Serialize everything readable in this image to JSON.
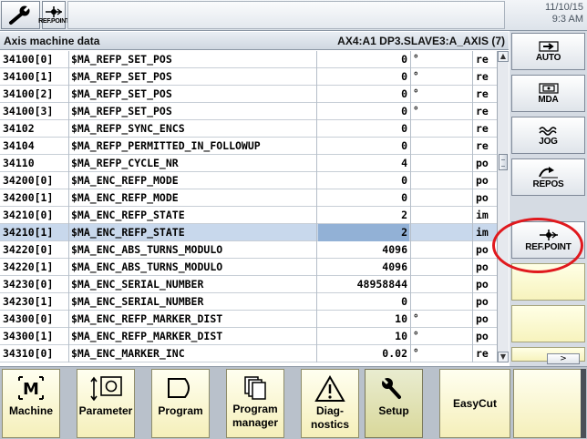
{
  "topbar": {
    "refpoint_label": "REF.POINT",
    "date": "11/10/15",
    "time": "9:3 AM"
  },
  "header": {
    "title": "Axis machine data",
    "axis_info": "AX4:A1 DP3.SLAVE3:A_AXIS (7)"
  },
  "table": {
    "rows": [
      {
        "num": "34100[0]",
        "name": "$MA_REFP_SET_POS",
        "value": "0",
        "unit": "°",
        "act": "re",
        "selected": false
      },
      {
        "num": "34100[1]",
        "name": "$MA_REFP_SET_POS",
        "value": "0",
        "unit": "°",
        "act": "re",
        "selected": false
      },
      {
        "num": "34100[2]",
        "name": "$MA_REFP_SET_POS",
        "value": "0",
        "unit": "°",
        "act": "re",
        "selected": false
      },
      {
        "num": "34100[3]",
        "name": "$MA_REFP_SET_POS",
        "value": "0",
        "unit": "°",
        "act": "re",
        "selected": false
      },
      {
        "num": "34102",
        "name": "$MA_REFP_SYNC_ENCS",
        "value": "0",
        "unit": "",
        "act": "re",
        "selected": false
      },
      {
        "num": "34104",
        "name": "$MA_REFP_PERMITTED_IN_FOLLOWUP",
        "value": "0",
        "unit": "",
        "act": "re",
        "selected": false
      },
      {
        "num": "34110",
        "name": "$MA_REFP_CYCLE_NR",
        "value": "4",
        "unit": "",
        "act": "po",
        "selected": false
      },
      {
        "num": "34200[0]",
        "name": "$MA_ENC_REFP_MODE",
        "value": "0",
        "unit": "",
        "act": "po",
        "selected": false
      },
      {
        "num": "34200[1]",
        "name": "$MA_ENC_REFP_MODE",
        "value": "0",
        "unit": "",
        "act": "po",
        "selected": false
      },
      {
        "num": "34210[0]",
        "name": "$MA_ENC_REFP_STATE",
        "value": "2",
        "unit": "",
        "act": "im",
        "selected": false
      },
      {
        "num": "34210[1]",
        "name": "$MA_ENC_REFP_STATE",
        "value": "2",
        "unit": "",
        "act": "im",
        "selected": true
      },
      {
        "num": "34220[0]",
        "name": "$MA_ENC_ABS_TURNS_MODULO",
        "value": "4096",
        "unit": "",
        "act": "po",
        "selected": false
      },
      {
        "num": "34220[1]",
        "name": "$MA_ENC_ABS_TURNS_MODULO",
        "value": "4096",
        "unit": "",
        "act": "po",
        "selected": false
      },
      {
        "num": "34230[0]",
        "name": "$MA_ENC_SERIAL_NUMBER",
        "value": "48958844",
        "unit": "",
        "act": "po",
        "selected": false
      },
      {
        "num": "34230[1]",
        "name": "$MA_ENC_SERIAL_NUMBER",
        "value": "0",
        "unit": "",
        "act": "po",
        "selected": false
      },
      {
        "num": "34300[0]",
        "name": "$MA_ENC_REFP_MARKER_DIST",
        "value": "10",
        "unit": "°",
        "act": "po",
        "selected": false
      },
      {
        "num": "34300[1]",
        "name": "$MA_ENC_REFP_MARKER_DIST",
        "value": "10",
        "unit": "°",
        "act": "po",
        "selected": false
      },
      {
        "num": "34310[0]",
        "name": "$MA_ENC_MARKER_INC",
        "value": "0.02",
        "unit": "°",
        "act": "re",
        "selected": false
      }
    ]
  },
  "scrollbar": {
    "position_fraction": 0.34
  },
  "vertical_softkeys": [
    {
      "label": "AUTO",
      "icon": "auto-arrow-icon"
    },
    {
      "label": "MDA",
      "icon": "mda-icon"
    },
    {
      "label": "JOG",
      "icon": "jog-wave-icon"
    },
    {
      "label": "REPOS",
      "icon": "repos-arrow-icon"
    },
    {
      "label": "REF.POINT",
      "icon": "refpoint-icon"
    },
    {
      "label": "",
      "icon": ""
    },
    {
      "label": "",
      "icon": ""
    },
    {
      "label": "",
      "icon": ""
    }
  ],
  "vertical_next_label": ">",
  "horizontal_softkeys": [
    {
      "label": "Machine",
      "icon": "machine-icon"
    },
    {
      "label": "Parameter",
      "icon": "parameter-icon"
    },
    {
      "label": "Program",
      "icon": "program-icon"
    },
    {
      "label": "Program manager",
      "icon": "program-manager-icon"
    },
    {
      "label": "Diag-nostics",
      "icon": "diagnostics-warning-icon"
    },
    {
      "label": "Setup",
      "icon": "wrench-icon",
      "active": true
    },
    {
      "label": "EasyCut",
      "icon": ""
    }
  ],
  "hsk_labels": {
    "program_manager_1": "Program",
    "program_manager_2": "manager",
    "diagnostics_1": "Diag-",
    "diagnostics_2": "nostics"
  },
  "colors": {
    "selection": "#c8d8ec",
    "annotation": "#e0191e",
    "softkey_yellow": "#f5efba"
  }
}
